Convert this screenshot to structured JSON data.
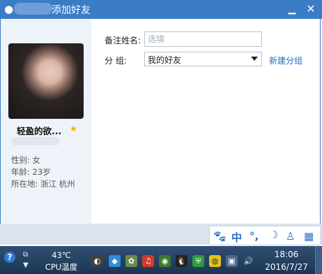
{
  "window": {
    "title": "添加好友"
  },
  "profile": {
    "nickname": "轻盈的欲...",
    "gender_label": "性别:",
    "gender": "女",
    "age_label": "年龄:",
    "age": "23岁",
    "location_label": "所在地:",
    "location": "浙江  杭州"
  },
  "form": {
    "remark_label": "备注姓名:",
    "remark_placeholder": "选填",
    "group_label": "分    组:",
    "group_value": "我的好友",
    "new_group_link": "新建分组"
  },
  "ime": {
    "mode": "中",
    "punct": "°,",
    "moon": "☽"
  },
  "taskbar": {
    "cpu_temp": "43℃",
    "cpu_label": "CPU温度",
    "time": "18:06",
    "date": "2016/7/27"
  },
  "colors": {
    "titlebar": "#3a7cc6",
    "link": "#1a6fc3",
    "taskbar": "#1d3553"
  }
}
